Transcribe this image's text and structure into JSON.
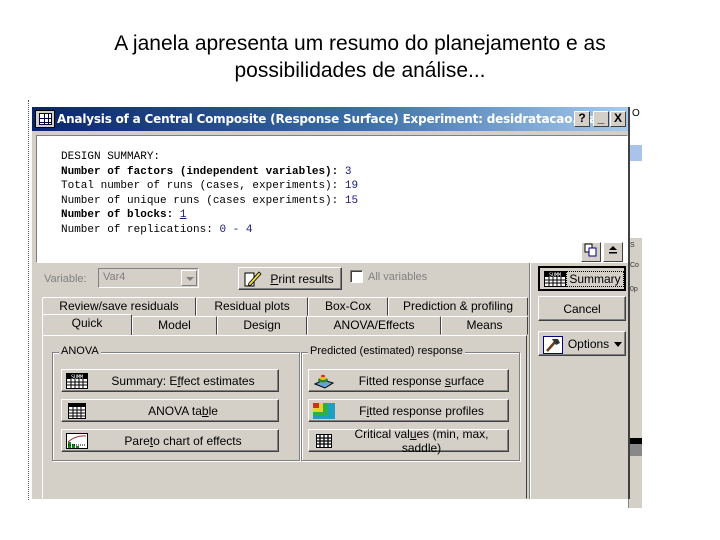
{
  "slide": {
    "title_line1": "A janela apresenta um resumo do planejamento e as",
    "title_line2": "possibilidades de análise..."
  },
  "window": {
    "title": "Analysis of a Central Composite (Response Surface) Experiment: desidratacao.sta",
    "icon": "spreadsheet-grid-icon",
    "controls": {
      "help": "?",
      "minimize": "_",
      "close": "X"
    }
  },
  "summary": {
    "heading": "DESIGN SUMMARY:",
    "lines": [
      {
        "label": "Number of factors (independent variables): ",
        "value": "3"
      },
      {
        "label": "Total number of runs (cases, experiments): ",
        "value": "19"
      },
      {
        "label": "Number of unique runs (cases experiments): ",
        "value": "15"
      },
      {
        "label": "Number of blocks: ",
        "value": "1"
      },
      {
        "label": "Number of replications: ",
        "value": "0 - 4"
      }
    ],
    "copy_icon": "copy-icon",
    "collapse_icon": "collapse-up-icon"
  },
  "controls": {
    "variable_label": "Variable:",
    "variable_value": "Var4",
    "print_results_pre": "",
    "print_results_u": "P",
    "print_results_post": "rint results",
    "all_variables_label": "All variables",
    "all_variables_checked": false,
    "summary_label": "Summary",
    "cancel_label": "Cancel",
    "options_label": "Options"
  },
  "tabs": {
    "back_row": [
      "Review/save residuals",
      "Residual plots",
      "Box-Cox",
      "Prediction & profiling"
    ],
    "front_row": [
      "Quick",
      "Model",
      "Design",
      "ANOVA/Effects",
      "Means"
    ],
    "active": "Quick"
  },
  "anova_group": {
    "legend": "ANOVA",
    "buttons": [
      {
        "pre": "Summary:  E",
        "u": "f",
        "post": "fect estimates",
        "icon": "summary-table-icon"
      },
      {
        "pre": "ANOVA ta",
        "u": "b",
        "post": "le",
        "icon": "anova-table-icon"
      },
      {
        "pre": "Pare",
        "u": "t",
        "post": "o chart of effects",
        "icon": "pareto-chart-icon"
      }
    ]
  },
  "predicted_group": {
    "legend": "Predicted (estimated) response",
    "buttons": [
      {
        "pre": "Fitted response ",
        "u": "s",
        "post": "urface",
        "icon": "surface-plot-icon"
      },
      {
        "pre": "F",
        "u": "i",
        "post": "tted response profiles",
        "icon": "contour-profile-icon"
      },
      {
        "pre": "Critical val",
        "u": "u",
        "post": "es (min, max, saddle)",
        "icon": "critical-values-grid-icon"
      }
    ]
  },
  "background": {
    "fragment_text_top": "O",
    "fragment_labels": [
      "S",
      "Co",
      "0p"
    ]
  }
}
